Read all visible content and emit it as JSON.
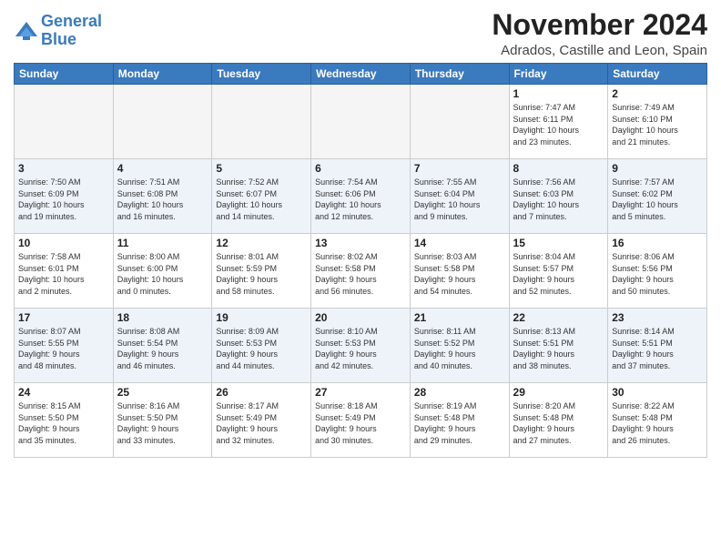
{
  "logo": {
    "line1": "General",
    "line2": "Blue"
  },
  "title": "November 2024",
  "location": "Adrados, Castille and Leon, Spain",
  "days_of_week": [
    "Sunday",
    "Monday",
    "Tuesday",
    "Wednesday",
    "Thursday",
    "Friday",
    "Saturday"
  ],
  "weeks": [
    [
      {
        "day": "",
        "info": ""
      },
      {
        "day": "",
        "info": ""
      },
      {
        "day": "",
        "info": ""
      },
      {
        "day": "",
        "info": ""
      },
      {
        "day": "",
        "info": ""
      },
      {
        "day": "1",
        "info": "Sunrise: 7:47 AM\nSunset: 6:11 PM\nDaylight: 10 hours\nand 23 minutes."
      },
      {
        "day": "2",
        "info": "Sunrise: 7:49 AM\nSunset: 6:10 PM\nDaylight: 10 hours\nand 21 minutes."
      }
    ],
    [
      {
        "day": "3",
        "info": "Sunrise: 7:50 AM\nSunset: 6:09 PM\nDaylight: 10 hours\nand 19 minutes."
      },
      {
        "day": "4",
        "info": "Sunrise: 7:51 AM\nSunset: 6:08 PM\nDaylight: 10 hours\nand 16 minutes."
      },
      {
        "day": "5",
        "info": "Sunrise: 7:52 AM\nSunset: 6:07 PM\nDaylight: 10 hours\nand 14 minutes."
      },
      {
        "day": "6",
        "info": "Sunrise: 7:54 AM\nSunset: 6:06 PM\nDaylight: 10 hours\nand 12 minutes."
      },
      {
        "day": "7",
        "info": "Sunrise: 7:55 AM\nSunset: 6:04 PM\nDaylight: 10 hours\nand 9 minutes."
      },
      {
        "day": "8",
        "info": "Sunrise: 7:56 AM\nSunset: 6:03 PM\nDaylight: 10 hours\nand 7 minutes."
      },
      {
        "day": "9",
        "info": "Sunrise: 7:57 AM\nSunset: 6:02 PM\nDaylight: 10 hours\nand 5 minutes."
      }
    ],
    [
      {
        "day": "10",
        "info": "Sunrise: 7:58 AM\nSunset: 6:01 PM\nDaylight: 10 hours\nand 2 minutes."
      },
      {
        "day": "11",
        "info": "Sunrise: 8:00 AM\nSunset: 6:00 PM\nDaylight: 10 hours\nand 0 minutes."
      },
      {
        "day": "12",
        "info": "Sunrise: 8:01 AM\nSunset: 5:59 PM\nDaylight: 9 hours\nand 58 minutes."
      },
      {
        "day": "13",
        "info": "Sunrise: 8:02 AM\nSunset: 5:58 PM\nDaylight: 9 hours\nand 56 minutes."
      },
      {
        "day": "14",
        "info": "Sunrise: 8:03 AM\nSunset: 5:58 PM\nDaylight: 9 hours\nand 54 minutes."
      },
      {
        "day": "15",
        "info": "Sunrise: 8:04 AM\nSunset: 5:57 PM\nDaylight: 9 hours\nand 52 minutes."
      },
      {
        "day": "16",
        "info": "Sunrise: 8:06 AM\nSunset: 5:56 PM\nDaylight: 9 hours\nand 50 minutes."
      }
    ],
    [
      {
        "day": "17",
        "info": "Sunrise: 8:07 AM\nSunset: 5:55 PM\nDaylight: 9 hours\nand 48 minutes."
      },
      {
        "day": "18",
        "info": "Sunrise: 8:08 AM\nSunset: 5:54 PM\nDaylight: 9 hours\nand 46 minutes."
      },
      {
        "day": "19",
        "info": "Sunrise: 8:09 AM\nSunset: 5:53 PM\nDaylight: 9 hours\nand 44 minutes."
      },
      {
        "day": "20",
        "info": "Sunrise: 8:10 AM\nSunset: 5:53 PM\nDaylight: 9 hours\nand 42 minutes."
      },
      {
        "day": "21",
        "info": "Sunrise: 8:11 AM\nSunset: 5:52 PM\nDaylight: 9 hours\nand 40 minutes."
      },
      {
        "day": "22",
        "info": "Sunrise: 8:13 AM\nSunset: 5:51 PM\nDaylight: 9 hours\nand 38 minutes."
      },
      {
        "day": "23",
        "info": "Sunrise: 8:14 AM\nSunset: 5:51 PM\nDaylight: 9 hours\nand 37 minutes."
      }
    ],
    [
      {
        "day": "24",
        "info": "Sunrise: 8:15 AM\nSunset: 5:50 PM\nDaylight: 9 hours\nand 35 minutes."
      },
      {
        "day": "25",
        "info": "Sunrise: 8:16 AM\nSunset: 5:50 PM\nDaylight: 9 hours\nand 33 minutes."
      },
      {
        "day": "26",
        "info": "Sunrise: 8:17 AM\nSunset: 5:49 PM\nDaylight: 9 hours\nand 32 minutes."
      },
      {
        "day": "27",
        "info": "Sunrise: 8:18 AM\nSunset: 5:49 PM\nDaylight: 9 hours\nand 30 minutes."
      },
      {
        "day": "28",
        "info": "Sunrise: 8:19 AM\nSunset: 5:48 PM\nDaylight: 9 hours\nand 29 minutes."
      },
      {
        "day": "29",
        "info": "Sunrise: 8:20 AM\nSunset: 5:48 PM\nDaylight: 9 hours\nand 27 minutes."
      },
      {
        "day": "30",
        "info": "Sunrise: 8:22 AM\nSunset: 5:48 PM\nDaylight: 9 hours\nand 26 minutes."
      }
    ]
  ]
}
